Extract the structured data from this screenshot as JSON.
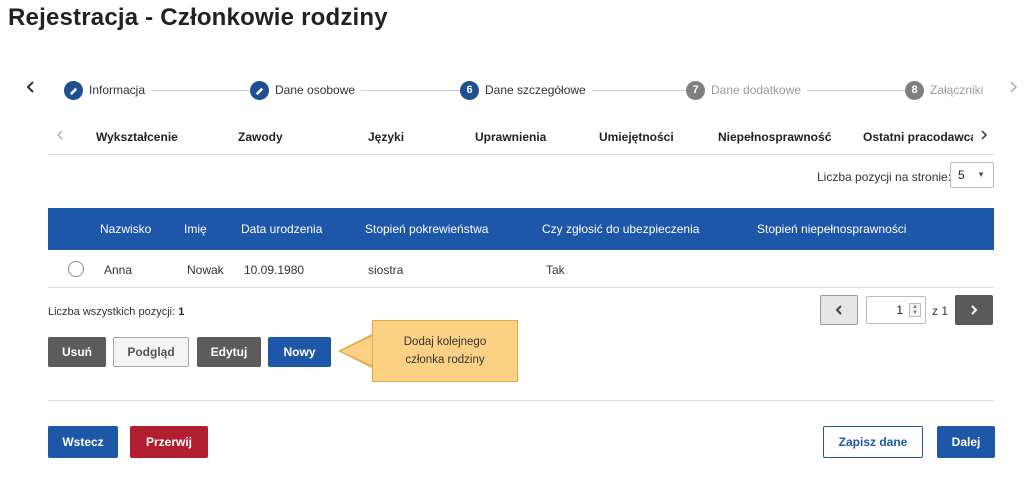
{
  "page_title": "Rejestracja - Członkowie rodziny",
  "stepper": {
    "prev_icon": "chevron-left-icon",
    "next_icon": "chevron-right-icon",
    "steps": [
      {
        "label": "Informacja",
        "state": "done",
        "icon": "check-icon",
        "number": ""
      },
      {
        "label": "Dane osobowe",
        "state": "done",
        "icon": "check-icon",
        "number": ""
      },
      {
        "label": "Dane szczegółowe",
        "state": "active",
        "icon": "",
        "number": "6"
      },
      {
        "label": "Dane dodatkowe",
        "state": "future",
        "icon": "",
        "number": "7"
      },
      {
        "label": "Załączniki",
        "state": "future",
        "icon": "",
        "number": "8"
      }
    ]
  },
  "subtabs": {
    "items": [
      "Wykształcenie",
      "Zawody",
      "Języki",
      "Uprawnienia",
      "Umiejętności",
      "Niepełnosprawność",
      "Ostatni pracodawca"
    ]
  },
  "per_page": {
    "label": "Liczba pozycji na stronie:",
    "value": "5"
  },
  "table": {
    "columns": [
      "Nazwisko",
      "Imię",
      "Data urodzenia",
      "Stopień pokrewieństwa",
      "Czy zgłosić do ubezpieczenia",
      "Stopień niepełnosprawności"
    ],
    "rows": [
      {
        "nazwisko": "Anna",
        "imie": "Nowak",
        "data_urodzenia": "10.09.1980",
        "pokrewienstwo": "siostra",
        "ubezpieczenie": "Tak",
        "niepelnosprawnosc": ""
      }
    ]
  },
  "total": {
    "label": "Liczba wszystkich pozycji:",
    "value": "1"
  },
  "pager": {
    "current": "1",
    "of_label": "z 1"
  },
  "actions": {
    "delete": "Usuń",
    "preview": "Podgląd",
    "edit": "Edytuj",
    "new": "Nowy"
  },
  "callout": {
    "text": "Dodaj kolejnego członka rodziny",
    "color": "#fcd183"
  },
  "footer": {
    "back": "Wstecz",
    "cancel": "Przerwij",
    "save": "Zapisz dane",
    "next": "Dalej"
  },
  "colors": {
    "primary": "#1e56a8",
    "danger": "#b01e30",
    "gray": "#5c5c5c"
  }
}
